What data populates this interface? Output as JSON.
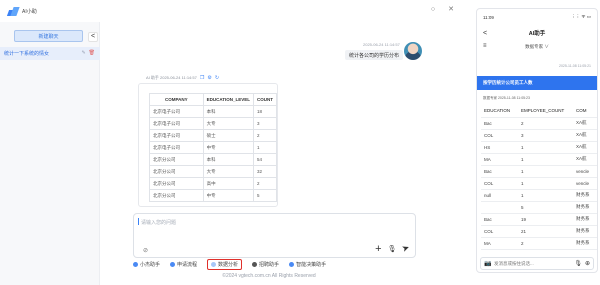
{
  "window": {
    "app_name": "AI小助",
    "controls": {
      "minimize": "○",
      "close": "✕"
    }
  },
  "sidebar": {
    "new_chat_label": "新建聊天",
    "collapse_label": "<",
    "history": [
      {
        "label": "统计一下系统的情女"
      }
    ]
  },
  "chat": {
    "user_timestamp": "2025-06-24 11:14:57",
    "user_message": "统计各公司的学历分布",
    "ai_header": "AI 助手 2025-06-24 11:14:57",
    "result_table": {
      "columns": [
        "COMPANY",
        "EDUCATION_LEVEL",
        "COUNT"
      ],
      "rows": [
        [
          "北京电子公司",
          "本科",
          "18"
        ],
        [
          "北京电子公司",
          "大专",
          "3"
        ],
        [
          "北京电子公司",
          "硕士",
          "2"
        ],
        [
          "北京电子公司",
          "中专",
          "1"
        ],
        [
          "北京分公司",
          "本科",
          "54"
        ],
        [
          "北京分公司",
          "大专",
          "32"
        ],
        [
          "北京分公司",
          "高中",
          "2"
        ],
        [
          "北京分公司",
          "中专",
          "5"
        ]
      ]
    },
    "input_placeholder": "请输入您的问题",
    "tools": [
      {
        "label": "小杰助手",
        "color": "#4a8af4"
      },
      {
        "label": "申请流程",
        "color": "#4a8af4"
      },
      {
        "label": "数据分析",
        "color": "#a7c7f7",
        "active": true
      },
      {
        "label": "招聘助手",
        "color": "#555555"
      },
      {
        "label": "智能决策助手",
        "color": "#4a8af4"
      }
    ],
    "copyright": "©2024 vgtech.com.cn All Rights Reserved"
  },
  "phone": {
    "status_time": "11:09",
    "status_icons": "⋮⋮ ᯤ ▭",
    "back": "<",
    "title": "AI助手",
    "menu": "≡",
    "model_select": "数据专家 ∨",
    "message_timestamp": "2025-11-08 11:05:21",
    "user_message": "按学历统计公司员工人数",
    "ai_label": "数据专家 2025-11-08 11:05:23",
    "table": {
      "columns": [
        "EDUCATION",
        "EMPLOYEE_COUNT",
        "COM"
      ],
      "rows": [
        [
          "Bac",
          "2",
          "XA航"
        ],
        [
          "COL",
          "3",
          "XA航"
        ],
        [
          "HS",
          "1",
          "XA航"
        ],
        [
          "MA",
          "1",
          "XA航"
        ],
        [
          "Bac",
          "1",
          "vencle"
        ],
        [
          "COL",
          "1",
          "vencle"
        ],
        [
          "null",
          "1",
          "财务系"
        ],
        [
          "",
          "5",
          "财务系"
        ],
        [
          "Bac",
          "19",
          "财务系"
        ],
        [
          "COL",
          "21",
          "财务系"
        ],
        [
          "MA",
          "2",
          "财务系"
        ]
      ]
    },
    "input_placeholder": "发消息或按住说话..."
  }
}
